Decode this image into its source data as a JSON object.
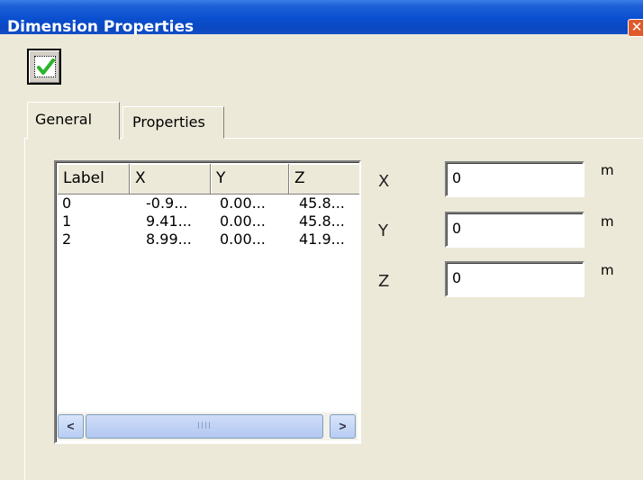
{
  "window": {
    "title": "Dimension Properties",
    "close_glyph": "✕"
  },
  "toolbar": {
    "ok_icon": "checkmark-icon"
  },
  "tabs": [
    {
      "label": "General",
      "active": true
    },
    {
      "label": "Properties",
      "active": false
    }
  ],
  "point_list": {
    "columns": [
      "Label",
      "X",
      "Y",
      "Z"
    ],
    "rows": [
      [
        "0",
        "-0.9...",
        "0.00...",
        "45.8..."
      ],
      [
        "1",
        "9.41...",
        "0.00...",
        "45.8..."
      ],
      [
        "2",
        "8.99...",
        "0.00...",
        "41.9..."
      ]
    ],
    "scroll_left": "<",
    "scroll_right": ">",
    "thumb_grip": "IIII"
  },
  "fields": [
    {
      "label": "X",
      "value": "0",
      "unit": "m"
    },
    {
      "label": "Y",
      "value": "0",
      "unit": "m"
    },
    {
      "label": "Z",
      "value": "0",
      "unit": "m"
    }
  ],
  "colors": {
    "titlebar": "#0a4fcf",
    "face": "#ece9d8",
    "accent_check": "#2bb52b"
  }
}
